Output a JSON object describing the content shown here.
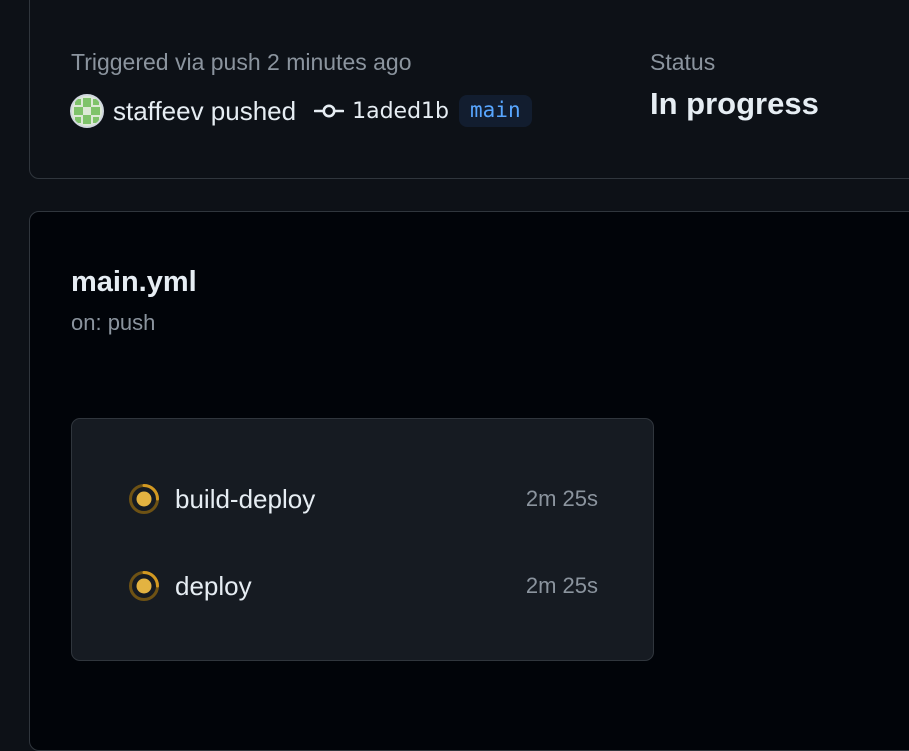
{
  "summary": {
    "trigger_text": "Triggered via push 2 minutes ago",
    "actor_text": "staffeev pushed",
    "commit_sha": "1aded1b",
    "branch": "main",
    "status_label": "Status",
    "status_value": "In progress"
  },
  "workflow": {
    "name": "main.yml",
    "trigger": "on: push",
    "jobs": [
      {
        "name": "build-deploy",
        "duration": "2m 25s",
        "status": "in-progress"
      },
      {
        "name": "deploy",
        "duration": "2m 25s",
        "status": "in-progress"
      }
    ]
  },
  "colors": {
    "page_background": "#0d1117",
    "graph_background": "#010409",
    "border": "#30363d",
    "text_primary": "#e6edf3",
    "text_muted": "#8b949e",
    "branch_accent": "#58a6ff",
    "in_progress": "#d29922"
  },
  "icons": {
    "avatar": "identicon-avatar",
    "commit": "git-commit-icon",
    "job_status": "in-progress-spinner-icon"
  }
}
